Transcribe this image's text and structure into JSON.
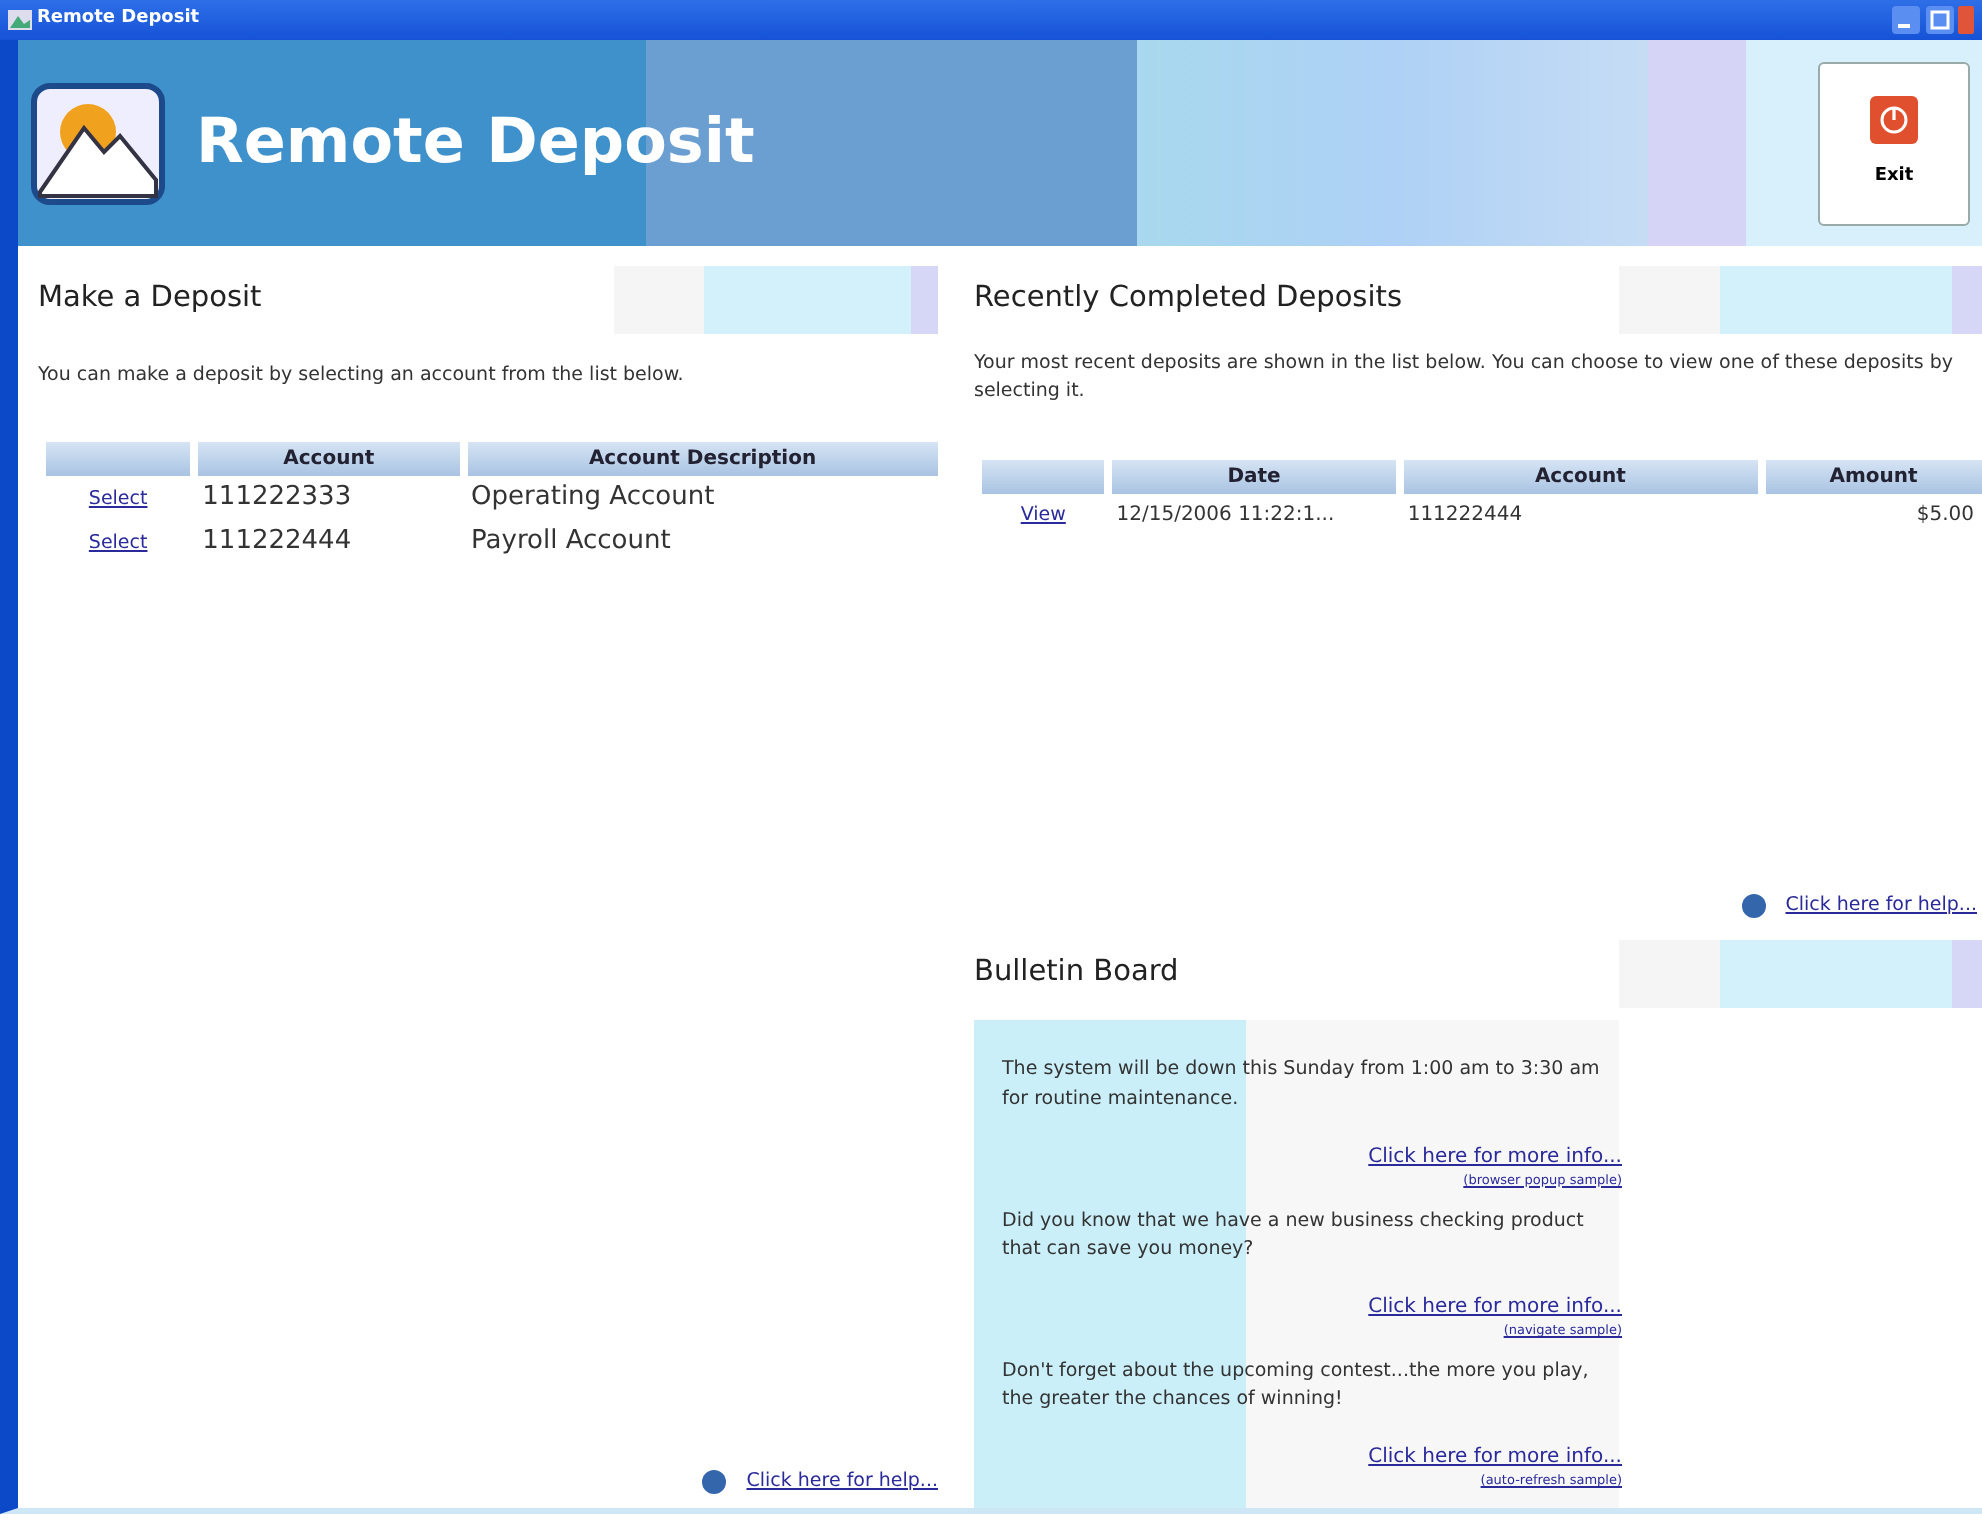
{
  "window": {
    "title": "Remote Deposit"
  },
  "banner": {
    "title": "Remote Deposit",
    "exit_label": "Exit"
  },
  "make_deposit": {
    "heading": "Make a Deposit",
    "intro": "You can make a deposit by selecting an account from the list below.",
    "columns": [
      "",
      "Account",
      "Account Description"
    ],
    "rows": [
      {
        "action": "Select",
        "account": "111222333",
        "description": "Operating Account"
      },
      {
        "action": "Select",
        "account": "111222444",
        "description": "Payroll Account"
      }
    ],
    "help_link": "Click here for help..."
  },
  "recent_deposits": {
    "heading": "Recently Completed Deposits",
    "intro": "Your most recent deposits are shown in the list below. You can choose to view one of these deposits by selecting it.",
    "columns": [
      "",
      "Date",
      "Account",
      "Amount"
    ],
    "rows": [
      {
        "action": "View",
        "date": "12/15/2006 11:22:1...",
        "account": "111222444",
        "amount": "$5.00"
      }
    ],
    "help_link": "Click here for help..."
  },
  "bulletin_board": {
    "heading": "Bulletin Board",
    "messages": [
      {
        "text": "The system will be down this Sunday from 1:00 am to 3:30 am for routine maintenance.",
        "link": "Click here for more info...",
        "note": "(browser popup sample)"
      },
      {
        "text": "Did you know that we have a new business checking product that can save you money?",
        "link": "Click here for more info...",
        "note": "(navigate sample)"
      },
      {
        "text": "Don't forget about the upcoming contest...the more you play, the greater the chances of winning!",
        "link": "Click here for more info...",
        "note": "(auto-refresh sample)"
      }
    ]
  }
}
